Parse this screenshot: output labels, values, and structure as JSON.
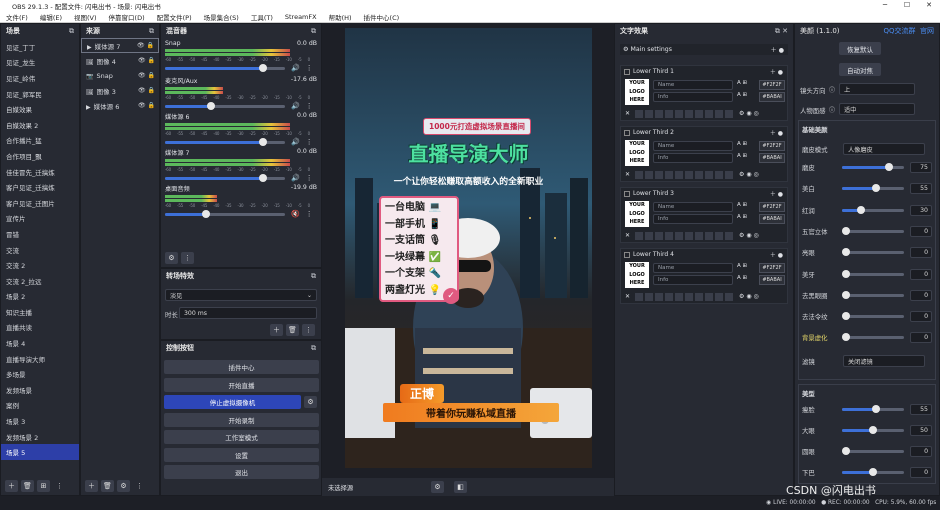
{
  "window": {
    "title": "OBS 29.1.3 - 配置文件: 闪电出书 - 场景: 闪电出书",
    "minimize": "─",
    "maximize": "☐",
    "close": "✕"
  },
  "menu": [
    "文件(F)",
    "编辑(E)",
    "视图(V)",
    "停靠窗口(D)",
    "配置文件(P)",
    "场景集合(S)",
    "工具(T)",
    "StreamFX",
    "帮助(H)",
    "插件中心(C)"
  ],
  "scenes": {
    "title": "场景",
    "items": [
      "见证_丁丁",
      "见证_龙生",
      "见证_岭伟",
      "见证_郭军民",
      "自媒效果",
      "自媒效果 2",
      "合作播片_猛",
      "合作项目_飘",
      "佳佳冒先_迁搞炼",
      "客户见证_迁搞炼",
      "客户见证_迁图片",
      "宣传片",
      "冒错",
      "交流",
      "交流 2",
      "交流 2_拉远",
      "场景 2",
      "知识主播",
      "直播共读",
      "场景 4",
      "直播导演大师",
      "多场景",
      "发频场景",
      "案例",
      "场景 3",
      "发频场景 2",
      "场景 5"
    ],
    "selected_index": 26
  },
  "sources": {
    "title": "来源",
    "items": [
      {
        "name": "媒体源 7",
        "icon": "play-icon"
      },
      {
        "name": "图像 4",
        "icon": "image-icon"
      },
      {
        "name": "Snap",
        "icon": "camera-icon"
      },
      {
        "name": "图像 3",
        "icon": "image-icon"
      },
      {
        "name": "媒体源 6",
        "icon": "play-icon"
      }
    ]
  },
  "mixer": {
    "title": "混音器",
    "channels": [
      {
        "name": "Snap",
        "db": "0.0 dB",
        "level": 0.82,
        "muted": false
      },
      {
        "name": "麦克风/Aux",
        "db": "-17.6 dB",
        "level": 0.38,
        "muted": false
      },
      {
        "name": "媒体源 6",
        "db": "0.0 dB",
        "level": 0.82,
        "muted": false
      },
      {
        "name": "媒体源 7",
        "db": "0.0 dB",
        "level": 0.82,
        "muted": false
      },
      {
        "name": "桌面音频",
        "db": "-19.9 dB",
        "level": 0.34,
        "muted": true
      }
    ],
    "ticks": [
      "-60",
      "-55",
      "-50",
      "-45",
      "-40",
      "-35",
      "-30",
      "-25",
      "-20",
      "-15",
      "-10",
      "-5",
      "0"
    ]
  },
  "transitions": {
    "title": "转场特效",
    "type": "淡见",
    "duration_label": "时长",
    "duration": "300 ms"
  },
  "controls": {
    "title": "控制按钮",
    "buttons": [
      "插件中心",
      "开始直播",
      "停止虚拟摄像机",
      "开始录制",
      "工作室模式",
      "设置",
      "退出"
    ],
    "active_index": 2
  },
  "preview": {
    "banner": "1000元打造虚拟场景直播间",
    "headline": "直播导演大师",
    "subline": "一个让你轻松赚取高额收入的全新职业",
    "list": [
      "一台电脑 💻",
      "一部手机 📱",
      "一支话筒 🎙",
      "一块绿幕 ✅",
      "一个支架 🔦",
      "两盏灯光 💡"
    ],
    "name_tag": "正博",
    "slogan": "带着你玩赚私域直播",
    "bottom_label": "未选择源"
  },
  "text_effects": {
    "title": "文字效果",
    "main_settings": "Main settings",
    "thirds": [
      {
        "label": "Lower Third 1",
        "color1": "#F2F2F",
        "color2": "#BABAI"
      },
      {
        "label": "Lower Third 2",
        "color1": "#F2F2F",
        "color2": "#BABAI"
      },
      {
        "label": "Lower Third 3",
        "color1": "#F2F2F",
        "color2": "#BABAI"
      },
      {
        "label": "Lower Third 4",
        "color1": "#F2F2F",
        "color2": "#BABAI"
      }
    ],
    "logo_lines": [
      "YOUR",
      "LOGO",
      "HERE"
    ],
    "name_placeholder": "Name",
    "info_placeholder": "Info"
  },
  "beauty": {
    "title": "美颜 (1.1.0)",
    "qq_group": "QQ交流群",
    "website": "官网",
    "btn_default": "恢复默认",
    "btn_auto": "自动对焦",
    "lens_dir_label": "镜头方向",
    "lens_dir": "上",
    "face_label": "人物面感",
    "face": "适中",
    "section_basic": "基础美颜",
    "mode_label": "磨皮模式",
    "mode": "人像磨皮",
    "sliders": [
      {
        "name": "磨皮",
        "value": "75",
        "frac": 0.75
      },
      {
        "name": "美白",
        "value": "55",
        "frac": 0.55
      },
      {
        "name": "红润",
        "value": "30",
        "frac": 0.3
      },
      {
        "name": "五官立体",
        "value": "0",
        "frac": 0
      },
      {
        "name": "亮眼",
        "value": "0",
        "frac": 0
      },
      {
        "name": "美牙",
        "value": "0",
        "frac": 0
      },
      {
        "name": "去黑眼圈",
        "value": "0",
        "frac": 0
      },
      {
        "name": "去法令纹",
        "value": "0",
        "frac": 0
      },
      {
        "name": "背景虚化",
        "value": "0",
        "frac": 0
      }
    ],
    "filter_label": "滤镜",
    "filter": "关闭滤镜",
    "section_shape": "美型",
    "shape_sliders": [
      {
        "name": "瘦脸",
        "value": "55",
        "frac": 0.55
      },
      {
        "name": "大眼",
        "value": "50",
        "frac": 0.5
      },
      {
        "name": "圆眼",
        "value": "0",
        "frac": 0
      },
      {
        "name": "下巴",
        "value": "0",
        "frac": 0.5
      }
    ]
  },
  "status": {
    "live": "LIVE: 00:00:00",
    "rec": "REC: 00:00:00",
    "cpu": "CPU: 5.9%, 60.00 fps",
    "watermark": "CSDN @闪电出书"
  },
  "colors": {
    "accent": "#2d3fa8",
    "panel": "#272a33",
    "bg": "#1d1f26"
  }
}
